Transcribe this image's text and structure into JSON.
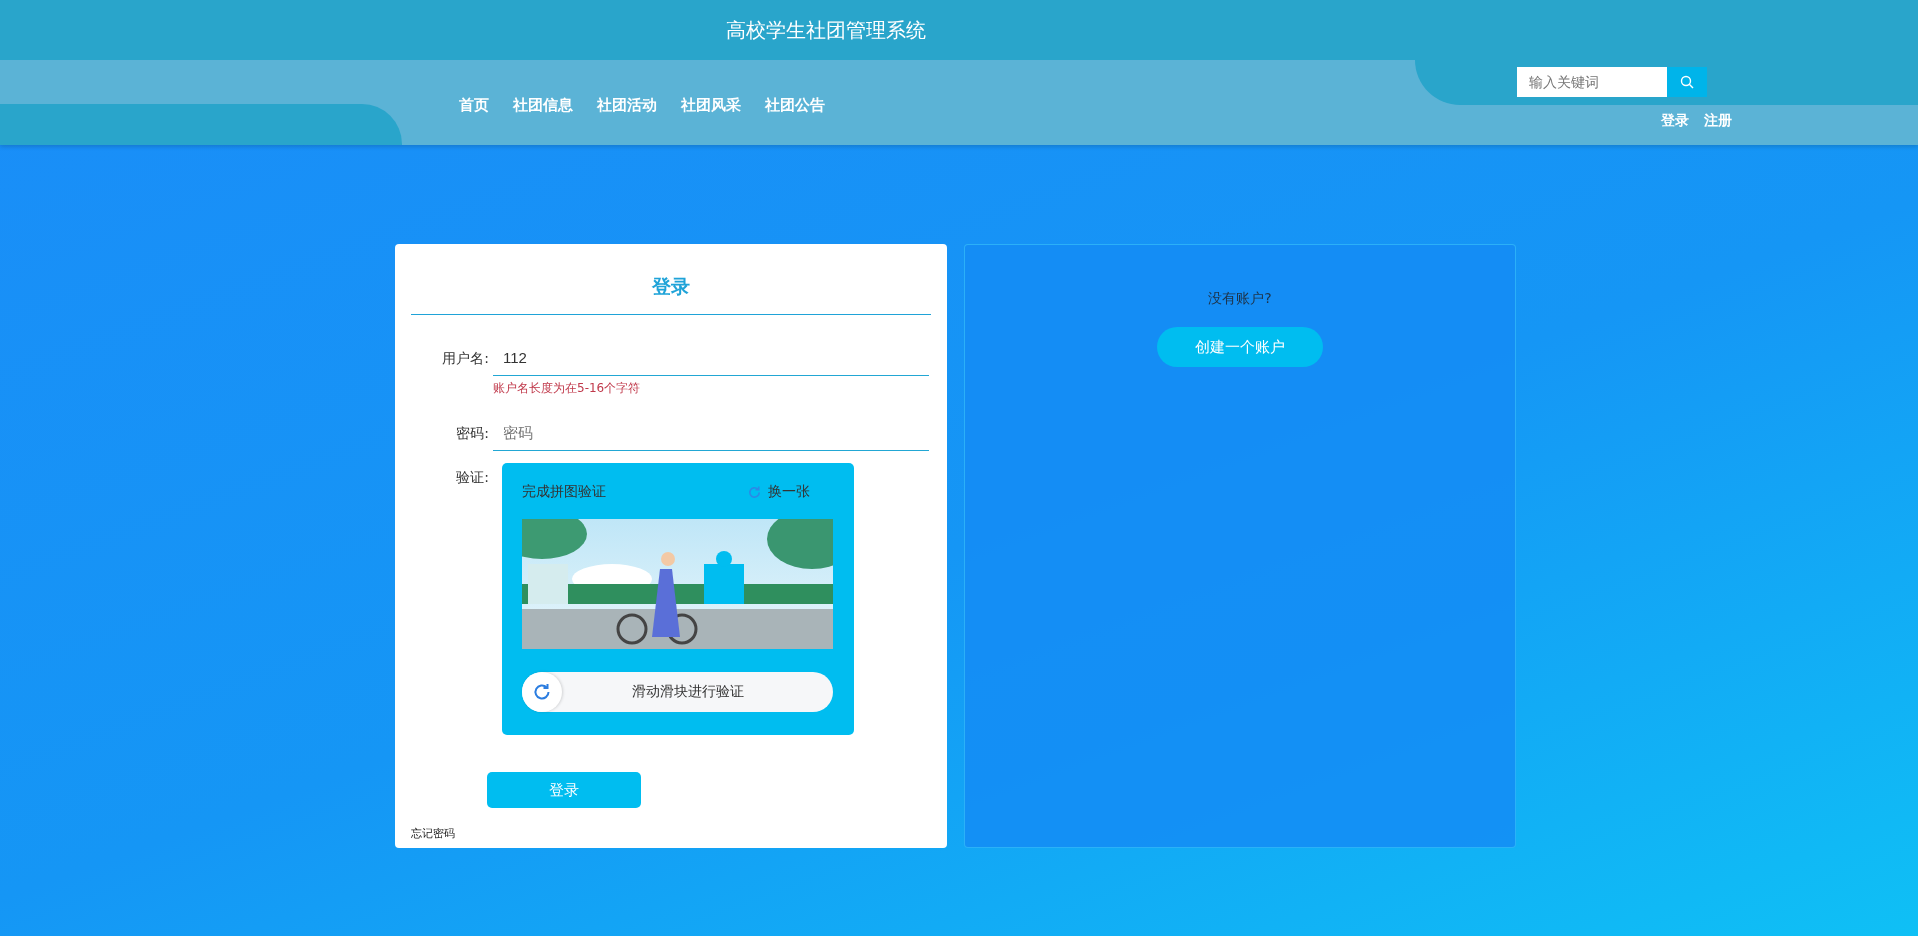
{
  "header": {
    "title": "高校学生社团管理系统",
    "nav": [
      {
        "label": "首页"
      },
      {
        "label": "社团信息"
      },
      {
        "label": "社团活动"
      },
      {
        "label": "社团风采"
      },
      {
        "label": "社团公告"
      }
    ],
    "search": {
      "placeholder": "输入关键词"
    },
    "auth_links": [
      "登录",
      "注册"
    ]
  },
  "login": {
    "title": "登录",
    "fields": [
      {
        "label": "用户名:",
        "value": "112",
        "error": "账户名长度为在5-16个字符"
      },
      {
        "label": "密码:",
        "placeholder": "密码"
      }
    ],
    "captcha": {
      "label": "验证:",
      "prompt": "完成拼图验证",
      "refresh": "换一张",
      "slider_hint": "滑动滑块进行验证"
    },
    "submit": "登录",
    "forgot": "忘记密码"
  },
  "signup": {
    "prompt": "没有账户?",
    "button": "创建一个账户"
  }
}
